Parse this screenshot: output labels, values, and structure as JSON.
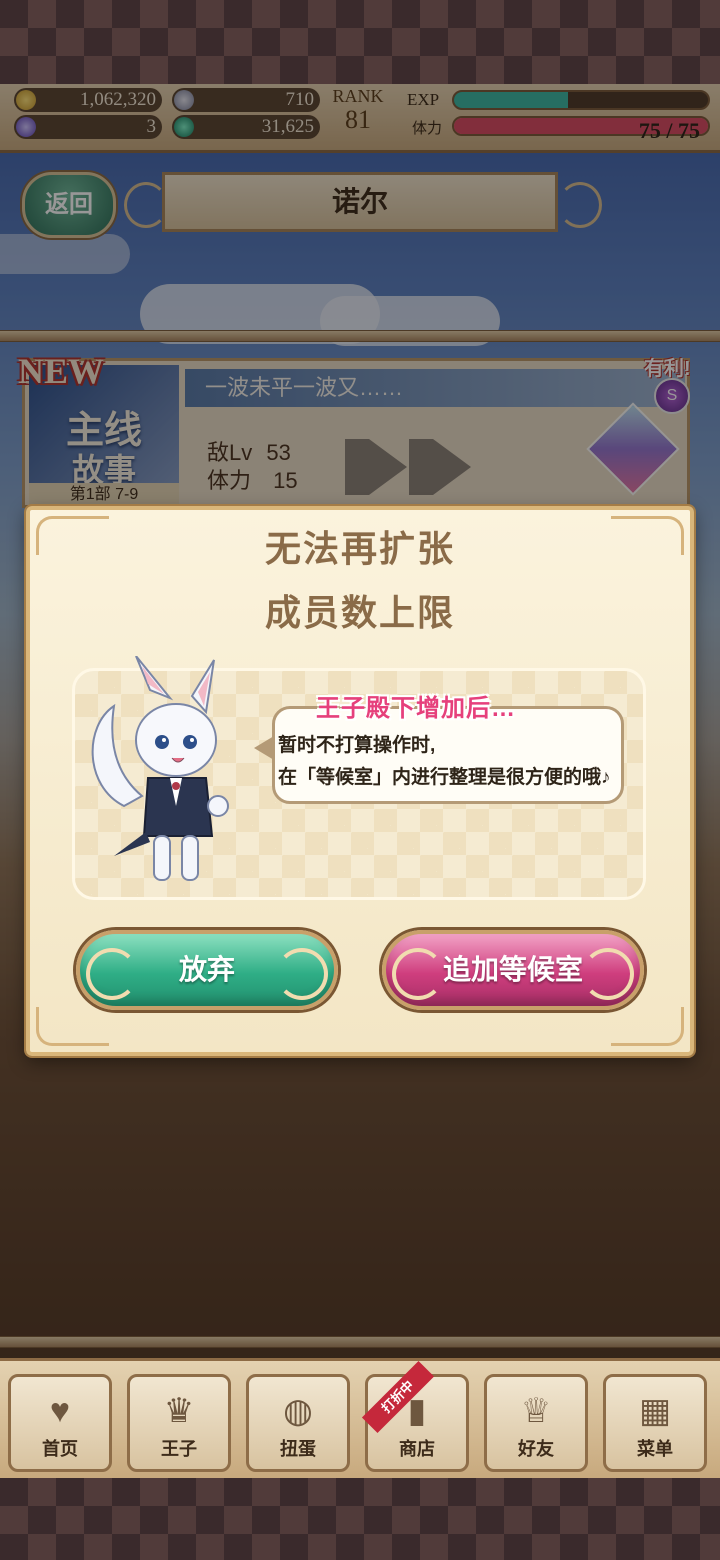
{
  "header": {
    "gold": "1,062,320",
    "feather": "710",
    "gem": "3",
    "orb": "31,625",
    "rank_label": "RANK",
    "rank_value": "81",
    "exp_label": "EXP",
    "exp_progress": 0.45,
    "stamina_label": "体力",
    "stamina_value": "75 / 75",
    "stamina_progress": 1.0,
    "colors": {
      "exp": "#3cb8a4",
      "stamina": "#d94a62"
    }
  },
  "title_bar": {
    "back_label": "返回",
    "title": "诺尔"
  },
  "quest": {
    "new_badge": "NEW",
    "bonus_badge": "有利!",
    "thumb_line1": "主线",
    "thumb_line2": "故事",
    "chapter": "第1部 7-9",
    "title": "一波未平一波又……",
    "enemy_lv_label": "敌Lv",
    "enemy_lv": "53",
    "stamina_label": "体力",
    "stamina_cost": "15",
    "bonus_icon_text": "S"
  },
  "modal": {
    "title_line1": "无法再扩张",
    "title_line2": "成员数上限",
    "bubble_heading": "王子殿下增加后…",
    "bubble_line1": "暂时不打算操作时,",
    "bubble_line2": "在「等候室」内进行整理是很方便的哦♪",
    "cancel_label": "放弃",
    "add_label": "追加等候室"
  },
  "nav": {
    "sale_ribbon": "打折中",
    "items": [
      {
        "label": "首页",
        "icon": "heart-icon"
      },
      {
        "label": "王子",
        "icon": "crown-icon"
      },
      {
        "label": "扭蛋",
        "icon": "capsule-icon"
      },
      {
        "label": "商店",
        "icon": "shop-icon"
      },
      {
        "label": "好友",
        "icon": "tiara-icon"
      },
      {
        "label": "菜单",
        "icon": "grid-icon"
      }
    ]
  }
}
